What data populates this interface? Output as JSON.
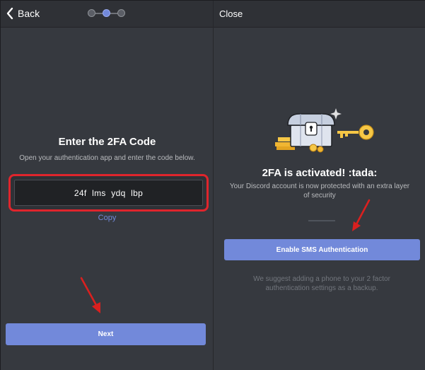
{
  "left_panel": {
    "back_label": "Back",
    "steps": {
      "count": 3,
      "active_index": 1
    },
    "title": "Enter the 2FA Code",
    "subtitle": "Open your authentication app and enter the code below.",
    "code_value": "24f lms ydq lbp",
    "copy_label": "Copy",
    "next_label": "Next"
  },
  "right_panel": {
    "close_label": "Close",
    "title": "2FA is activated! :tada:",
    "message": "Your Discord account is now protected with an extra layer of security",
    "sms_button_label": "Enable SMS Authentication",
    "suggestion": "We suggest adding a phone to your 2 factor authentication settings as a backup."
  },
  "colors": {
    "background": "#36393f",
    "topbar": "#2f3136",
    "accent": "#7289da",
    "highlight_box": "#e0252c",
    "annotation_arrow": "#d9201f"
  },
  "icons": {
    "back": "chevron-left-icon",
    "illustration": "treasure-chest-key-illustration"
  }
}
